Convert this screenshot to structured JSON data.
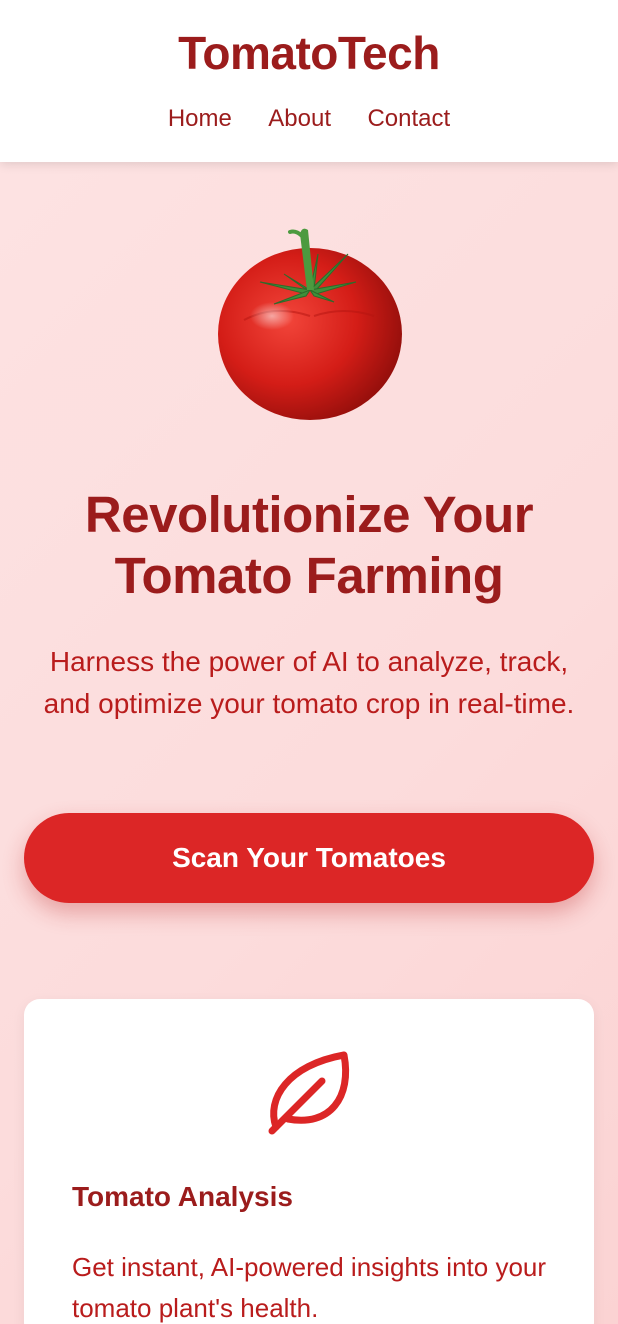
{
  "header": {
    "brand": "TomatoTech",
    "nav": [
      "Home",
      "About",
      "Contact"
    ]
  },
  "hero": {
    "image_icon": "tomato",
    "headline": "Revolutionize Your Tomato Farming",
    "subtext": "Harness the power of AI to analyze, track, and optimize your tomato crop in real-time.",
    "cta_label": "Scan Your Tomatoes"
  },
  "features": [
    {
      "icon": "leaf-icon",
      "title": "Tomato Analysis",
      "description": "Get instant, AI-powered insights into your tomato plant's health."
    }
  ],
  "colors": {
    "brand": "#9b1c1c",
    "accent": "#dc2626",
    "background": "#fde0e0",
    "card": "#ffffff"
  }
}
